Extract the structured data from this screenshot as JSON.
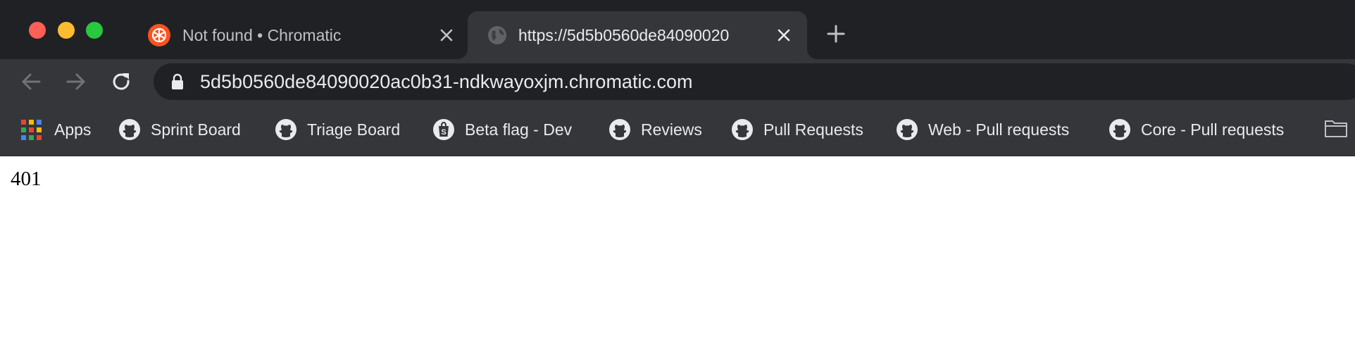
{
  "window": {
    "traffic_lights": [
      "close",
      "minimize",
      "zoom"
    ]
  },
  "tabs": [
    {
      "title": "Not found • Chromatic",
      "icon": "chromatic-logo-icon",
      "active": false
    },
    {
      "title": "https://5d5b0560de84090020",
      "icon": "globe-icon",
      "active": true
    }
  ],
  "toolbar": {
    "url": "5d5b0560de84090020ac0b31-ndkwayoxjm.chromatic.com"
  },
  "bookmarks": [
    {
      "label": "Apps",
      "icon": "apps-grid-icon"
    },
    {
      "label": "Sprint Board",
      "icon": "github-icon"
    },
    {
      "label": "Triage Board",
      "icon": "github-icon"
    },
    {
      "label": "Beta flag - Dev",
      "icon": "shopify-icon"
    },
    {
      "label": "Reviews",
      "icon": "github-icon"
    },
    {
      "label": "Pull Requests",
      "icon": "github-icon"
    },
    {
      "label": "Web - Pull requests",
      "icon": "github-icon"
    },
    {
      "label": "Core - Pull requests",
      "icon": "github-icon"
    }
  ],
  "page": {
    "body_text": "401"
  },
  "colors": {
    "tab_strip": "#202124",
    "toolbar": "#35363a",
    "omnibox": "#202124",
    "chromatic_brand": "#fc521f",
    "page_background": "#ffffff"
  }
}
